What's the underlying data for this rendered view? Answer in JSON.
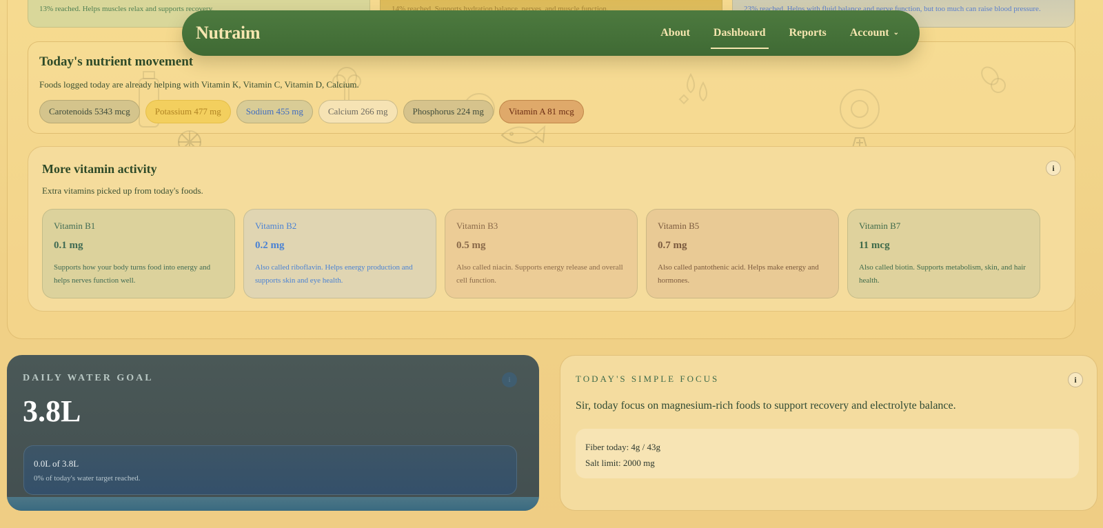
{
  "top_cards": [
    {
      "text": "13% reached. Helps muscles relax and supports recovery."
    },
    {
      "text": "14% reached. Supports hydration balance, nerves, and muscle function."
    },
    {
      "text": "23% reached. Helps with fluid balance and nerve function, but too much can raise blood pressure."
    }
  ],
  "nav": {
    "brand": "Nutraim",
    "links": [
      {
        "label": "About"
      },
      {
        "label": "Dashboard",
        "active": true
      },
      {
        "label": "Reports"
      },
      {
        "label": "Account"
      }
    ]
  },
  "movement": {
    "title": "Today's nutrient movement",
    "description": "Foods logged today are already helping with Vitamin K, Vitamin C, Vitamin D, Calcium.",
    "chips": [
      {
        "label": "Carotenoids 5343 mcg"
      },
      {
        "label": "Potassium 477 mg"
      },
      {
        "label": "Sodium 455 mg"
      },
      {
        "label": "Calcium 266 mg"
      },
      {
        "label": "Phosphorus 224 mg"
      },
      {
        "label": "Vitamin A 81 mcg"
      }
    ]
  },
  "vitamins": {
    "title": "More vitamin activity",
    "subtitle": "Extra vitamins picked up from today's foods.",
    "info": "i",
    "cards": [
      {
        "name": "Vitamin B1",
        "value": "0.1 mg",
        "desc": "Supports how your body turns food into energy and helps nerves function well."
      },
      {
        "name": "Vitamin B2",
        "value": "0.2 mg",
        "desc": "Also called riboflavin. Helps energy production and supports skin and eye health."
      },
      {
        "name": "Vitamin B3",
        "value": "0.5 mg",
        "desc": "Also called niacin. Supports energy release and overall cell function."
      },
      {
        "name": "Vitamin B5",
        "value": "0.7 mg",
        "desc": "Also called pantothenic acid. Helps make energy and hormones."
      },
      {
        "name": "Vitamin B7",
        "value": "11 mcg",
        "desc": "Also called biotin. Supports metabolism, skin, and hair health."
      }
    ]
  },
  "water": {
    "title": "DAILY WATER GOAL",
    "info": "i",
    "goal": "3.8L",
    "progress_line": "0.0L of 3.8L",
    "progress_note": "0% of today's water target reached.",
    "progress_fraction": 0
  },
  "focus": {
    "title": "TODAY'S SIMPLE FOCUS",
    "info": "i",
    "message": "Sir, today focus on magnesium-rich foods to support recovery and electrolyte balance.",
    "fiber": "Fiber today: 4g / 43g",
    "salt": "Salt limit: 2000 mg"
  }
}
